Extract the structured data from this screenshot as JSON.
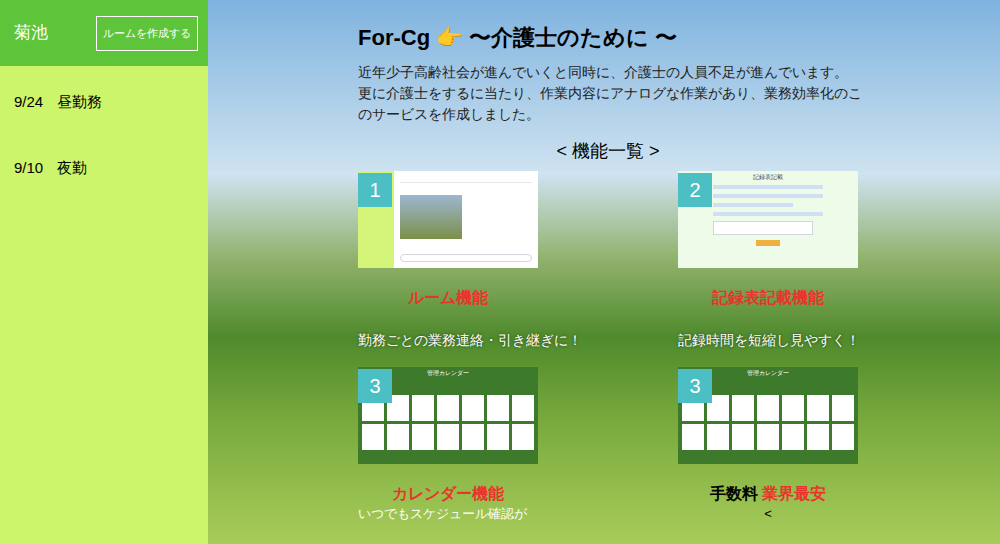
{
  "sidebar": {
    "user": "菊池",
    "create_button": "ルームを作成する",
    "items": [
      {
        "date": "9/24",
        "label": "昼勤務",
        "selected": false
      },
      {
        "date": "9/10",
        "label": "夜勤",
        "selected": false
      }
    ]
  },
  "hero": {
    "title": "For-Cg 👉 〜介護士のために 〜",
    "lines": [
      "近年少子高齢社会が進んでいくと同時に、介護士の人員不足が進んでいます。",
      "更に介護士をするに当たり、作業内容にアナログな作業があり、業務効率化のこ",
      "のサービスを作成しました。"
    ],
    "features_heading": "< 機能一覧 >"
  },
  "features": [
    {
      "number": "1",
      "kind": "room",
      "label": "ルーム機能",
      "label_prefix": "",
      "description": "勤務ごとの業務連絡・引き継ぎに！",
      "mock_title": "",
      "mock_lines": []
    },
    {
      "number": "2",
      "kind": "form",
      "label": "記録表記載機能",
      "label_prefix": "",
      "description": "記録時間を短縮し見やすく！",
      "mock_title": "記録表記載",
      "mock_lines": []
    },
    {
      "number": "3",
      "kind": "calendar",
      "label": "カレンダー機能",
      "label_prefix": "",
      "description": "",
      "mock_title": "管理カレンダー",
      "mock_lines": []
    },
    {
      "number": "3",
      "kind": "calendar",
      "label": "業界最安",
      "label_prefix": "手数料",
      "description": "",
      "mock_title": "管理カレンダー",
      "mock_lines": []
    }
  ],
  "footer": {
    "bottom_text": "いつでもスケジュール確認が",
    "caret": "<"
  }
}
